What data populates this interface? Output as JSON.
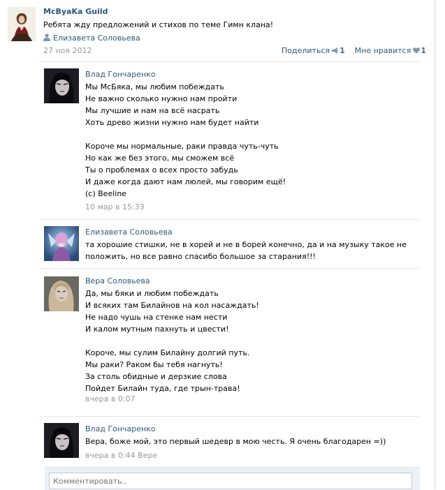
{
  "post": {
    "group_name": "McByaKa Guild",
    "text": "Ребята жду предложений и стихов по теме Гимн клана!",
    "author": "Елизавета Соловьева",
    "date": "27 ноя 2012",
    "share_label": "Поделиться",
    "share_count": "1",
    "like_label": "Мне нравится",
    "like_count": "1"
  },
  "comments": [
    {
      "name": "Влад Гончаренко",
      "lines": [
        "Мы McБяка, мы любим побеждать",
        "Не важно сколько нужно нам пройти",
        "Мы лучшие и нам на всё насрать",
        "Хоть древо жизни нужно нам будет найти",
        "",
        "Короче мы нормальные, раки правда чуть-чуть",
        "Но как же без этого, мы сможем всё",
        "Ты о проблемах о всех просто забудь",
        "И даже когда дают нам люлей, мы говорим ещё!",
        "(c) Beeline"
      ],
      "time": "10 мар в 15:33"
    },
    {
      "name": "Елизавета Соловьева",
      "text": "та хорошие стишки, не в хорей и не в борей конечно, да и на музыку такое не положить, но все равно спасибо большое за старания!!!"
    },
    {
      "name": "Вера Соловьева",
      "lines": [
        "Да, мы бяки и любим побеждать",
        "И всяких там Билайнов на кол насаждать!",
        "Не надо чушь на стенке нам нести",
        "И калом мутным пахнуть и цвести!",
        "",
        "Короче, мы сулим Билайну долгий путь.",
        "Мы раки? Раком бы тебя нагнуть!",
        "За столь обидные и дерзкие слова",
        "Пойдет Билайн туда, где трын-трава!"
      ],
      "time": "вчера в 0:07"
    },
    {
      "name": "Влад Гончаренко",
      "text": "Вера, боже мой, это первый шедевр в мою честь. Я очень благодарен =))",
      "time": "вчера в 0:44 Вере"
    }
  ],
  "comment_input": {
    "placeholder": "Комментировать.."
  },
  "colors": {
    "link": "#2b587a",
    "meta": "#999999",
    "border": "#e4e8ed",
    "comment_bg": "#edf1f5"
  },
  "icons": {
    "author": "user-icon",
    "share": "megaphone-icon",
    "like": "heart-icon"
  }
}
